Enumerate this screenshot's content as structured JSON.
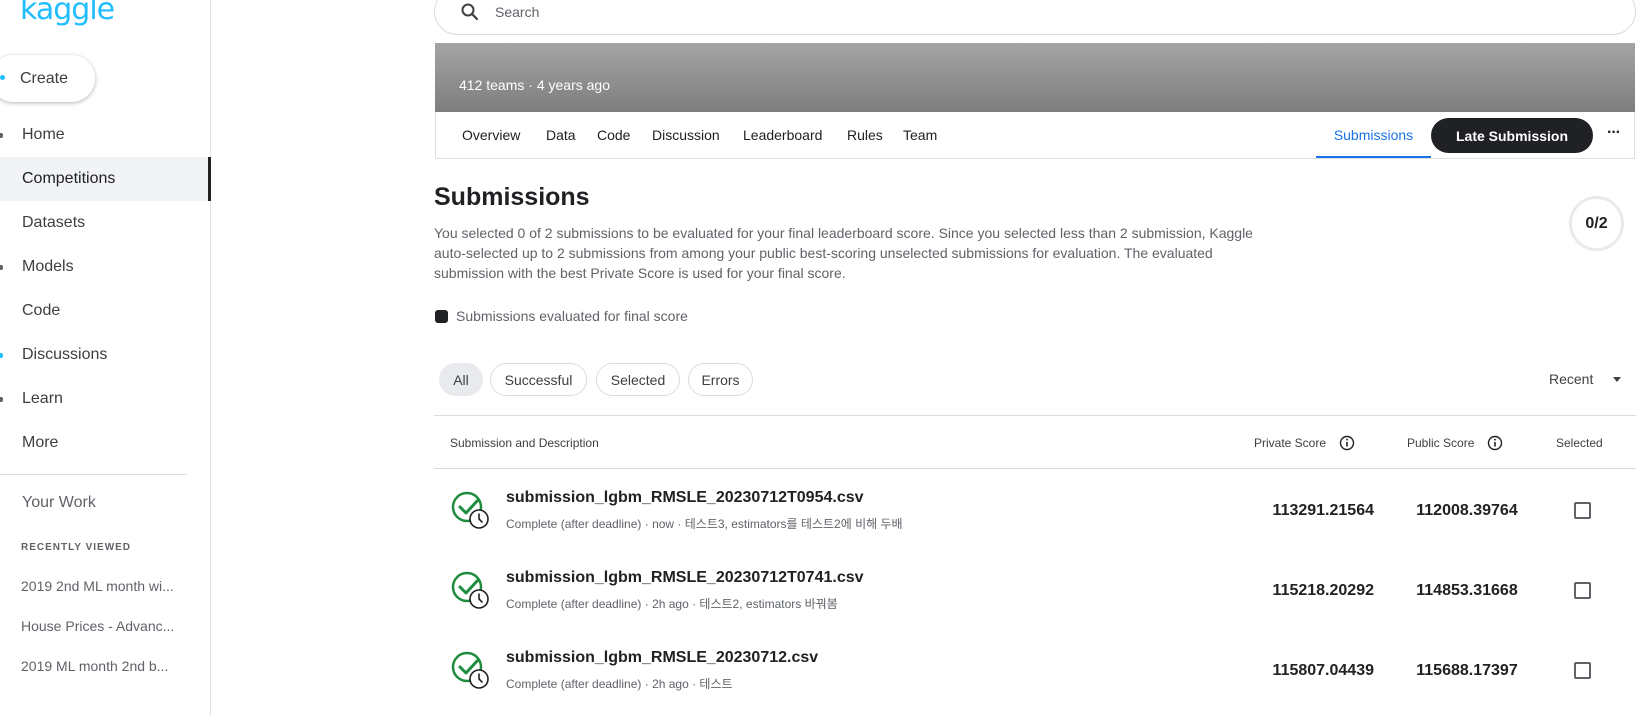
{
  "sidebar": {
    "logo": "kaggle",
    "create_label": "Create",
    "items": [
      {
        "label": "Home",
        "icon": "home-icon"
      },
      {
        "label": "Competitions",
        "icon": "trophy-icon",
        "active": true
      },
      {
        "label": "Datasets",
        "icon": "table-icon"
      },
      {
        "label": "Models",
        "icon": "models-icon"
      },
      {
        "label": "Code",
        "icon": "code-icon"
      },
      {
        "label": "Discussions",
        "icon": "comment-icon"
      },
      {
        "label": "Learn",
        "icon": "school-icon"
      },
      {
        "label": "More",
        "icon": "expand-icon"
      }
    ],
    "your_work": "Your Work",
    "recently_viewed_title": "RECENTLY VIEWED",
    "recently_viewed": [
      "2019 2nd ML month wi...",
      "House Prices - Advanc...",
      "2019 ML month 2nd b..."
    ]
  },
  "search": {
    "placeholder": "Search"
  },
  "banner": {
    "teams": "412 teams",
    "separator": "·",
    "age": "4 years ago"
  },
  "tabs": [
    "Overview",
    "Data",
    "Code",
    "Discussion",
    "Leaderboard",
    "Rules",
    "Team"
  ],
  "submissions_tab": "Submissions",
  "late_submission": "Late Submission",
  "more_dots": "···",
  "page": {
    "title": "Submissions",
    "description": "You selected 0 of 2 submissions to be evaluated for your final leaderboard score. Since you selected less than 2 submission, Kaggle auto-selected up to 2 submissions from among your public best-scoring unselected submissions for evaluation. The evaluated submission with the best Private Score is used for your final score.",
    "counter": "0/2",
    "legend": "Submissions evaluated for final score"
  },
  "filters": [
    "All",
    "Successful",
    "Selected",
    "Errors"
  ],
  "sort_label": "Recent",
  "table": {
    "headers": {
      "submission": "Submission and Description",
      "private": "Private Score",
      "public": "Public Score",
      "selected": "Selected"
    },
    "rows": [
      {
        "file": "submission_lgbm_RMSLE_20230712T0954.csv",
        "sub": "Complete (after deadline) · now · 테스트3, estimators를 테스트2에 비해 두배",
        "private": "113291.21564",
        "public": "112008.39764"
      },
      {
        "file": "submission_lgbm_RMSLE_20230712T0741.csv",
        "sub": "Complete (after deadline) · 2h ago · 테스트2, estimators 바꿔봄",
        "private": "115218.20292",
        "public": "114853.31668"
      },
      {
        "file": "submission_lgbm_RMSLE_20230712.csv",
        "sub": "Complete (after deadline) · 2h ago · 테스트",
        "private": "115807.04439",
        "public": "115688.17397"
      }
    ]
  },
  "colors": {
    "accent": "#20beff",
    "link": "#1a73e8",
    "success": "#1e8e3e",
    "dark": "#202124"
  }
}
